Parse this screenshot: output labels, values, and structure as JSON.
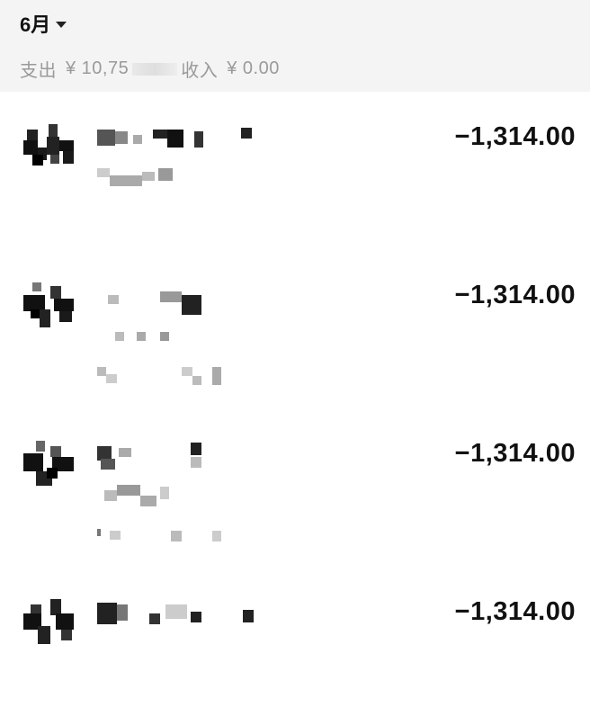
{
  "header": {
    "month_label": "6月",
    "expense_label": "支出",
    "expense_amount": "¥ 10,75",
    "income_label": "收入",
    "income_amount": "¥ 0.00"
  },
  "transactions": [
    {
      "amount": "−1,314.00"
    },
    {
      "amount": "−1,314.00"
    },
    {
      "amount": "−1,314.00"
    },
    {
      "amount": "−1,314.00"
    }
  ]
}
